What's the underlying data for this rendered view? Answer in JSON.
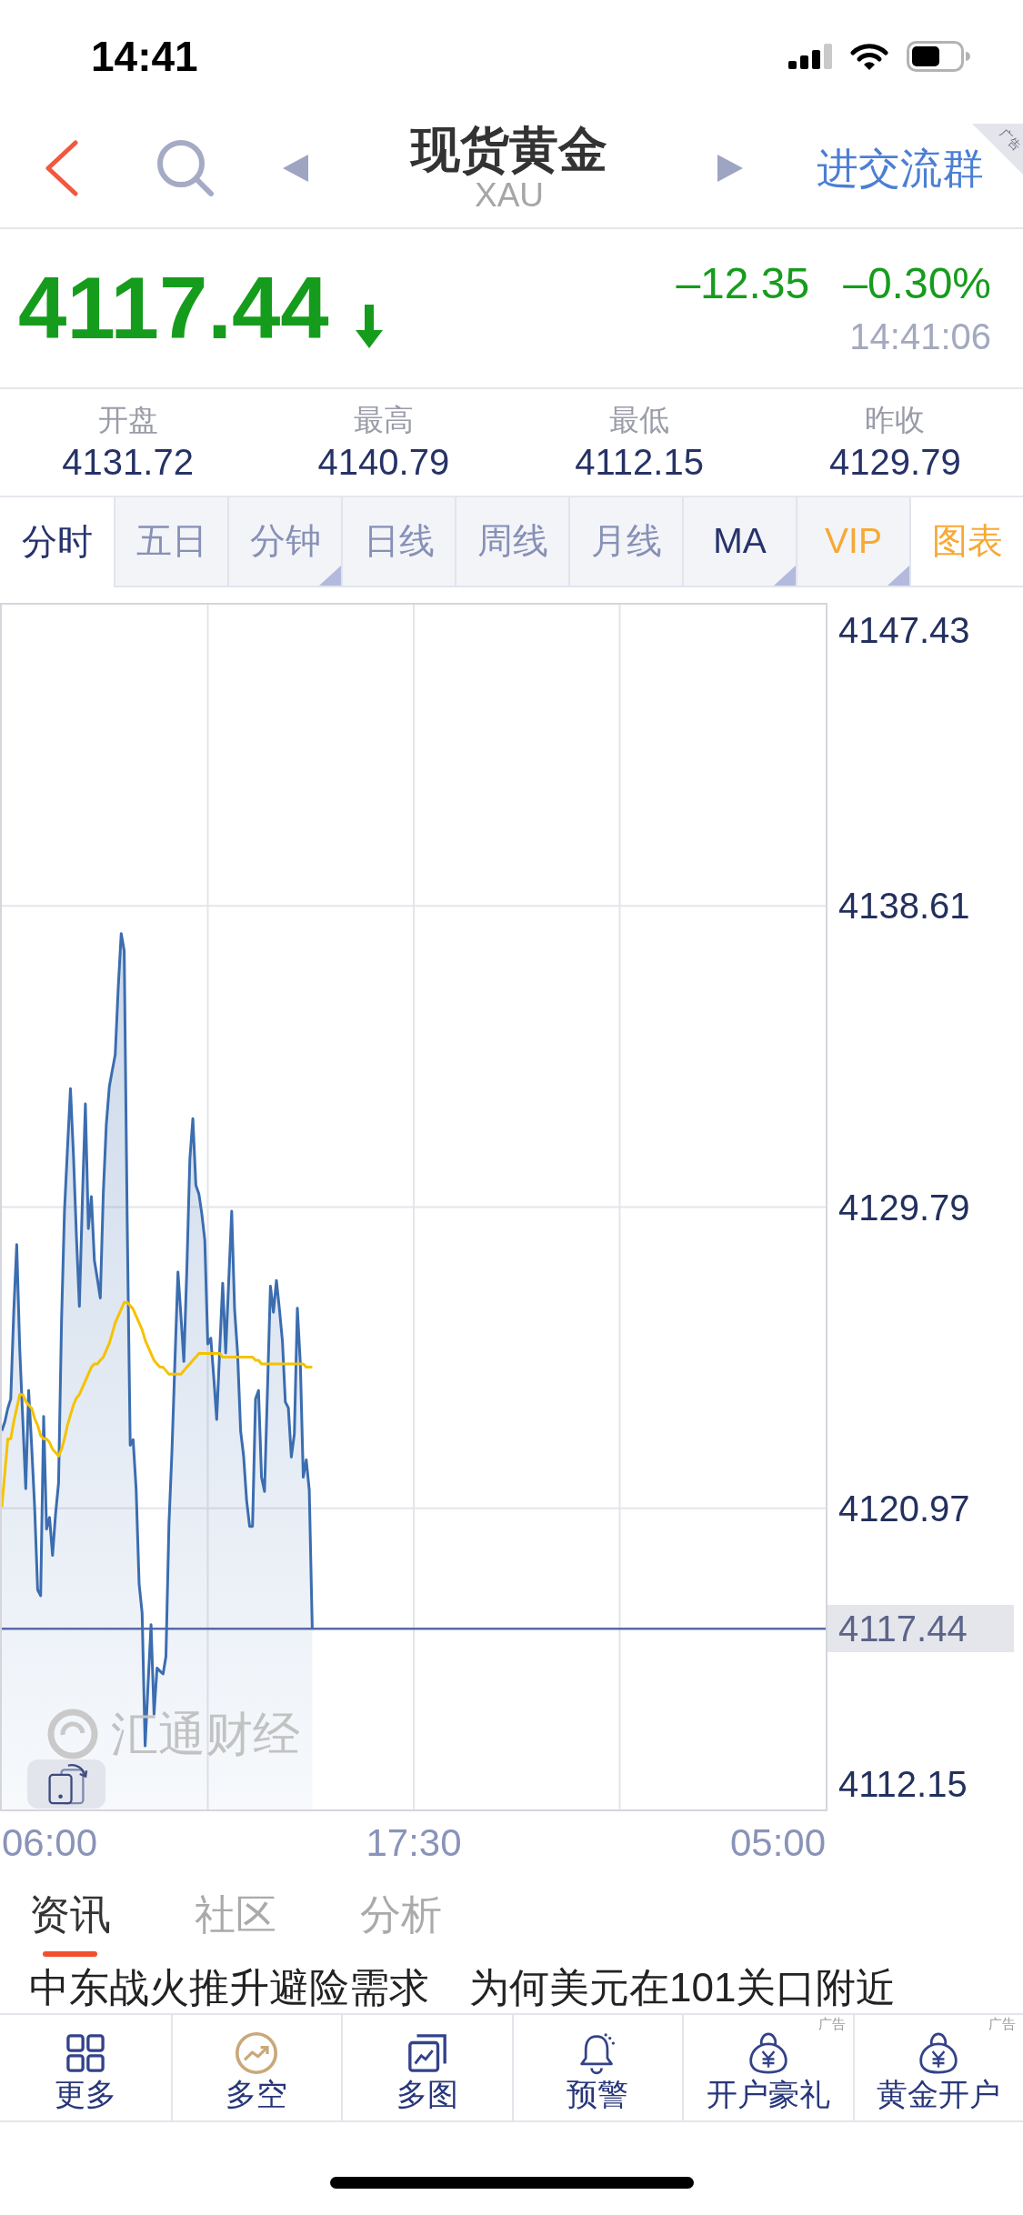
{
  "status_bar": {
    "time": "14:41"
  },
  "nav": {
    "title": "现货黄金",
    "subtitle": "XAU",
    "action": "进交流群",
    "ad_tag": "广告"
  },
  "quote": {
    "price": "4117.44",
    "down": true,
    "change": "–12.35",
    "change_percent": "–0.30%",
    "time": "14:41:06"
  },
  "stats": [
    {
      "label": "开盘",
      "value": "4131.72"
    },
    {
      "label": "最高",
      "value": "4140.79"
    },
    {
      "label": "最低",
      "value": "4112.15"
    },
    {
      "label": "昨收",
      "value": "4129.79"
    }
  ],
  "chart_tabs": [
    {
      "label": "分时",
      "selected": true,
      "kind": "period",
      "dropdown": false
    },
    {
      "label": "五日",
      "selected": false,
      "kind": "period",
      "dropdown": false
    },
    {
      "label": "分钟",
      "selected": false,
      "kind": "period",
      "dropdown": true
    },
    {
      "label": "日线",
      "selected": false,
      "kind": "period",
      "dropdown": false
    },
    {
      "label": "周线",
      "selected": false,
      "kind": "period",
      "dropdown": false
    },
    {
      "label": "月线",
      "selected": false,
      "kind": "period",
      "dropdown": false
    },
    {
      "label": "MA",
      "selected": false,
      "kind": "indicator",
      "dropdown": true
    },
    {
      "label": "VIP",
      "selected": false,
      "kind": "premium",
      "dropdown": true
    },
    {
      "label": "图表",
      "selected": false,
      "kind": "chart",
      "dropdown": false
    }
  ],
  "chart": {
    "watermark": "汇通财经",
    "current_price": "4117.44",
    "chart_data": {
      "type": "line",
      "grid": true,
      "categories": [
        null,
        null,
        null,
        null,
        null,
        null,
        null,
        null,
        null,
        null,
        null,
        null,
        null,
        null,
        null,
        null,
        "06:00",
        null,
        null,
        null,
        null,
        null,
        null,
        null,
        null,
        null,
        null,
        null,
        null,
        null,
        null,
        null,
        null,
        null,
        null,
        null,
        null,
        null,
        null,
        null,
        null,
        null,
        null,
        null,
        null,
        null,
        null,
        null,
        null,
        null,
        null,
        null,
        null,
        null,
        null,
        null,
        null,
        null,
        null,
        null,
        null,
        null,
        null,
        null,
        null,
        null,
        null,
        null,
        null,
        null,
        null,
        null,
        null,
        null,
        null,
        null,
        null,
        null,
        null,
        null,
        null,
        null,
        null,
        null,
        null,
        null,
        null,
        null,
        null,
        null,
        null,
        null,
        null,
        null,
        null,
        null,
        null,
        null,
        null,
        null,
        null,
        null,
        null,
        null,
        null,
        null,
        null,
        null,
        null,
        null,
        null,
        null,
        null,
        null,
        null,
        null,
        null,
        null,
        null,
        null,
        null,
        null,
        null,
        null,
        null,
        null,
        null,
        null,
        null,
        null,
        null,
        null,
        null,
        null,
        null,
        null,
        null,
        null,
        "17:30",
        null,
        null,
        null,
        null,
        null,
        null,
        null,
        null,
        null,
        null,
        null,
        null,
        null,
        null,
        null,
        null,
        null,
        null,
        null,
        null,
        null,
        null,
        null,
        null,
        null,
        null,
        null,
        null,
        null,
        null,
        null,
        null,
        null,
        null,
        null,
        null,
        null,
        null,
        null,
        null,
        null,
        null,
        null,
        null,
        null,
        null,
        null,
        null,
        null,
        null,
        null,
        null,
        null,
        null,
        null,
        null,
        null,
        null,
        null,
        null,
        null,
        null,
        null,
        null,
        null,
        null,
        null,
        null,
        null,
        null,
        null,
        null,
        null,
        null,
        null,
        null,
        null,
        null,
        null,
        null,
        null,
        null,
        null,
        null,
        null,
        null,
        null,
        null,
        null,
        null,
        null,
        null,
        null,
        null,
        null,
        null,
        null,
        null,
        null,
        null,
        null,
        null,
        null,
        null,
        null,
        null,
        null,
        null,
        null,
        null,
        null,
        null,
        null,
        null,
        null,
        null,
        null,
        null,
        null,
        null,
        null,
        "05:00",
        null,
        null,
        null,
        null,
        null,
        null,
        null,
        null,
        null,
        null,
        null,
        null,
        null,
        null,
        null,
        null
      ],
      "series": [
        {
          "color": "#3b6db0",
          "values": [
            4123.24,
            4123.5,
            4123.9,
            4124.17,
            4126.7,
            4128.69,
            4125.64,
            4123.6,
            4121.54,
            4124.42,
            4122.8,
            4121.0,
            4118.58,
            4118.41,
            4123.66,
            4120.36,
            4120.7,
            4119.59,
            4120.8,
            4121.71,
            4126.5,
            4129.67,
            4131.5,
            4133.26,
            4131.3,
            4128.9,
            4126.88,
            4130.0,
            4132.81,
            4129.16,
            4130.1,
            4128.23,
            4127.7,
            4127.13,
            4130.2,
            4132.21,
            4133.31,
            4133.8,
            4134.25,
            4136.2,
            4137.8,
            4137.29,
            4129.33,
            4122.81,
            4122.98,
            4121.54,
            4118.75,
            4117.9,
            4114.01,
            4115.8,
            4117.56,
            4114.94,
            4116.29,
            4116.2,
            4116.12,
            4116.63,
            4120.5,
            4122.64,
            4125.3,
            4127.89,
            4126.6,
            4125.27,
            4128.0,
            4131.2,
            4132.38,
            4130.43,
            4130.18,
            4129.6,
            4128.83,
            4125.78,
            4125.95,
            4124.8,
            4123.57,
            4125.6,
            4127.56,
            4125.52,
            4127.6,
            4129.67,
            4126.79,
            4125.5,
            4123.24,
            4122.5,
            4121.2,
            4120.44,
            4120.44,
            4124.17,
            4124.42,
            4121.88,
            4121.46,
            4124.5,
            4127.47,
            4126.71,
            4127.64,
            4126.8,
            4125.86,
            4124.08,
            4123.91,
            4122.47,
            4123.15,
            4126.83,
            4125.2,
            4121.88,
            4122.39,
            4121.5,
            4117.44,
            null,
            null,
            null,
            null,
            null,
            null,
            null,
            null,
            null,
            null,
            null,
            null,
            null,
            null,
            null,
            null,
            null,
            null,
            null,
            null,
            null,
            null,
            null,
            null,
            null,
            null,
            null,
            null,
            null,
            null,
            null,
            null,
            null,
            null,
            null,
            null,
            null,
            null,
            null,
            null,
            null,
            null,
            null,
            null,
            null,
            null,
            null,
            null,
            null,
            null,
            null,
            null,
            null,
            null,
            null,
            null,
            null,
            null,
            null,
            null,
            null,
            null,
            null,
            null,
            null,
            null,
            null,
            null,
            null,
            null,
            null,
            null,
            null,
            null,
            null,
            null,
            null,
            null,
            null,
            null,
            null,
            null,
            null,
            null,
            null,
            null,
            null,
            null,
            null,
            null,
            null,
            null,
            null,
            null,
            null,
            null,
            null,
            null,
            null,
            null,
            null,
            null,
            null,
            null,
            null,
            null,
            null,
            null,
            null,
            null,
            null,
            null,
            null,
            null,
            null,
            null,
            null,
            null,
            null,
            null,
            null,
            null,
            null,
            null,
            null,
            null,
            null,
            null,
            null,
            null,
            null,
            null,
            null,
            null,
            null,
            null,
            null,
            null,
            null,
            null,
            null,
            null,
            null,
            null,
            null,
            null,
            null,
            null,
            null,
            null,
            null,
            null,
            null,
            null,
            null,
            null,
            null,
            null,
            null,
            null,
            null,
            null,
            null,
            null,
            null,
            null,
            null,
            null,
            null,
            null,
            null,
            null
          ]
        },
        {
          "color": "#f5c200",
          "values": [
            4121.0,
            4122.0,
            4123.0,
            4123.0,
            4123.5,
            4123.9,
            4124.3,
            4124.3,
            4124.1,
            4124.0,
            4123.9,
            4123.6,
            4123.4,
            4123.1,
            4123.0,
            4123.0,
            4122.9,
            4122.7,
            4122.6,
            4122.5,
            4122.7,
            4123.0,
            4123.4,
            4123.7,
            4124.0,
            4124.2,
            4124.3,
            4124.5,
            4124.7,
            4124.9,
            4125.1,
            4125.2,
            4125.2,
            4125.3,
            4125.4,
            4125.6,
            4125.8,
            4126.1,
            4126.4,
            4126.6,
            4126.8,
            4127.0,
            4127.0,
            4126.9,
            4126.8,
            4126.6,
            4126.4,
            4126.2,
            4125.9,
            4125.7,
            4125.5,
            4125.3,
            4125.2,
            4125.1,
            4125.1,
            4125.0,
            4124.9,
            4124.9,
            4124.9,
            4124.9,
            4124.9,
            4125.0,
            4125.1,
            4125.2,
            4125.3,
            4125.4,
            4125.5,
            4125.5,
            4125.5,
            4125.5,
            4125.5,
            4125.5,
            4125.5,
            4125.5,
            4125.4,
            4125.4,
            4125.4,
            4125.4,
            4125.4,
            4125.4,
            4125.4,
            4125.4,
            4125.4,
            4125.4,
            4125.4,
            4125.3,
            4125.3,
            4125.2,
            4125.2,
            4125.2,
            4125.2,
            4125.2,
            4125.2,
            4125.2,
            4125.2,
            4125.2,
            4125.2,
            4125.2,
            4125.2,
            4125.2,
            4125.2,
            4125.2,
            4125.1,
            4125.1,
            4125.1,
            null,
            null,
            null,
            null,
            null,
            null,
            null,
            null,
            null,
            null,
            null,
            null,
            null,
            null,
            null,
            null,
            null,
            null,
            null,
            null,
            null,
            null,
            null,
            null,
            null,
            null,
            null,
            null,
            null,
            null,
            null,
            null,
            null,
            null,
            null,
            null,
            null,
            null,
            null,
            null,
            null,
            null,
            null,
            null,
            null,
            null,
            null,
            null,
            null,
            null,
            null,
            null,
            null,
            null,
            null,
            null,
            null,
            null,
            null,
            null,
            null,
            null,
            null,
            null,
            null,
            null,
            null,
            null,
            null,
            null,
            null,
            null,
            null,
            null,
            null,
            null,
            null,
            null,
            null,
            null,
            null,
            null,
            null,
            null,
            null,
            null,
            null,
            null,
            null,
            null,
            null,
            null,
            null,
            null,
            null,
            null,
            null,
            null,
            null,
            null,
            null,
            null,
            null,
            null,
            null,
            null,
            null,
            null,
            null,
            null,
            null,
            null,
            null,
            null,
            null,
            null,
            null,
            null,
            null,
            null,
            null,
            null,
            null,
            null,
            null,
            null,
            null,
            null,
            null,
            null,
            null,
            null,
            null,
            null,
            null,
            null,
            null,
            null,
            null,
            null,
            null,
            null,
            null,
            null,
            null,
            null,
            null,
            null,
            null,
            null,
            null,
            null,
            null,
            null,
            null,
            null,
            null,
            null,
            null,
            null,
            null,
            null,
            null,
            null,
            null,
            null,
            null,
            null,
            null,
            null,
            null,
            null
          ]
        }
      ],
      "ylim": [
        4112.15,
        4147.43
      ],
      "yticks": [
        4147.43,
        4138.61,
        4129.79,
        4120.97,
        4112.15
      ],
      "ref_lines": [
        {
          "axis": "y",
          "value": 4117.44
        }
      ]
    }
  },
  "news_tabs": [
    {
      "label": "资讯",
      "selected": true
    },
    {
      "label": "社区",
      "selected": false
    },
    {
      "label": "分析",
      "selected": false
    }
  ],
  "headline": "中东战火推升避险需求　为何美元在101关口附近",
  "toolbar": [
    {
      "label": "更多"
    },
    {
      "label": "多空"
    },
    {
      "label": "多图"
    },
    {
      "label": "预警"
    },
    {
      "label": "开户豪礼",
      "tag": "广告"
    },
    {
      "label": "黄金开户",
      "tag": "广告"
    }
  ]
}
